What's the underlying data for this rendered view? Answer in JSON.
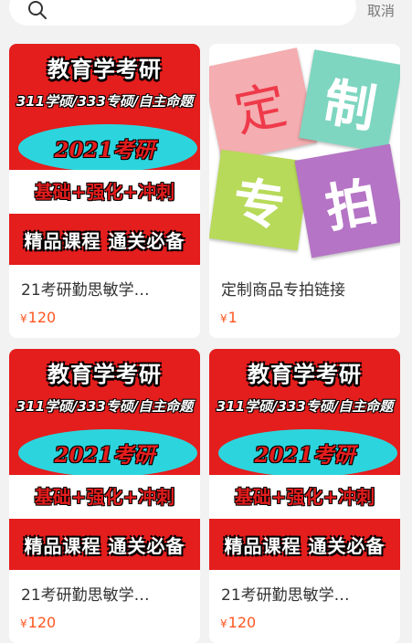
{
  "search": {
    "placeholder": ""
  },
  "cancel_label": "取消",
  "poster": {
    "title": "教育学考研",
    "subtitle": "311学硕/333专硕/自主命题",
    "year": "2021考研",
    "phases": "基础+强化+冲刺",
    "tagline": "精品课程  通关必备"
  },
  "custom_poster": {
    "chars": [
      "定",
      "制",
      "专",
      "拍"
    ]
  },
  "products": [
    {
      "title": "21考研勤思敏学…",
      "currency": "¥",
      "price": "120"
    },
    {
      "title": "定制商品专拍链接",
      "currency": "¥",
      "price": "1"
    },
    {
      "title": "21考研勤思敏学…",
      "currency": "¥",
      "price": "120"
    },
    {
      "title": "21考研勤思敏学…",
      "currency": "¥",
      "price": "120"
    }
  ],
  "icons": {
    "search": "search-icon"
  },
  "colors": {
    "price": "#ff5722",
    "poster_red": "#e41d1d",
    "poster_cyan": "#2cd5dd"
  }
}
